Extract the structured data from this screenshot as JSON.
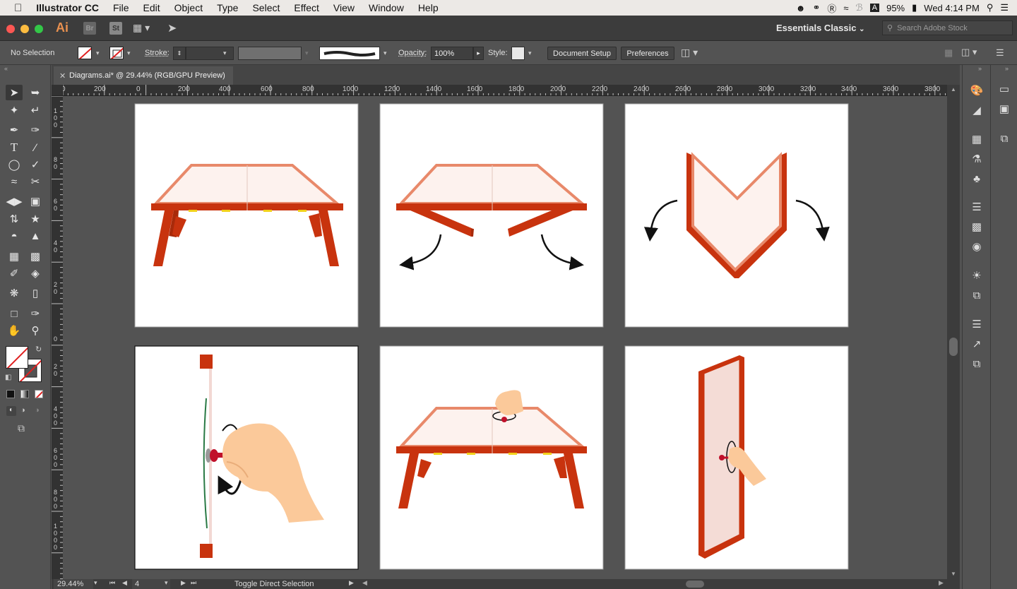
{
  "menubar": {
    "app_name": "Illustrator CC",
    "items": [
      "File",
      "Edit",
      "Object",
      "Type",
      "Select",
      "Effect",
      "View",
      "Window",
      "Help"
    ],
    "battery": "95%",
    "clock": "Wed 4:14 PM"
  },
  "appbar": {
    "ai_logo": "Ai",
    "bridge": "Br",
    "stock": "St",
    "workspace": "Essentials Classic",
    "search_placeholder": "Search Adobe Stock"
  },
  "control": {
    "selection": "No Selection",
    "stroke_label": "Stroke:",
    "opacity_label": "Opacity:",
    "opacity_value": "100%",
    "style_label": "Style:",
    "document_setup": "Document Setup",
    "preferences": "Preferences"
  },
  "document": {
    "tab_title": "Diagrams.ai* @ 29.44% (RGB/GPU Preview)"
  },
  "rulers": {
    "h_ticks": [
      "0",
      "200",
      "0",
      "200",
      "400",
      "600",
      "800",
      "1000",
      "1200",
      "1400",
      "1600",
      "1800",
      "2000",
      "2200",
      "2400",
      "2600",
      "2800",
      "3000",
      "3200",
      "3400",
      "3600",
      "3800"
    ],
    "v_ticks": [
      "1\n0\n0",
      "8\n0",
      "6\n0",
      "4\n0",
      "2\n0",
      "0",
      "2\n0",
      "4\n0\n0",
      "6\n0\n0",
      "8\n0\n0",
      "1\n0\n0\n0"
    ]
  },
  "status": {
    "zoom": "29.44%",
    "artboard_number": "4",
    "tool_hint": "Toggle Direct Selection"
  },
  "colors": {
    "table_red": "#c8330e",
    "table_top": "#fdf2ee",
    "table_edge": "#e8896a",
    "hand_skin": "#fbc99a",
    "pin_red": "#c0102a"
  },
  "icons": {
    "tools": [
      "selection-icon",
      "direct-selection-icon",
      "magic-wand-icon",
      "lasso-icon",
      "pen-icon",
      "curvature-icon",
      "type-icon",
      "line-icon",
      "ellipse-icon",
      "paintbrush-icon",
      "shaper-icon",
      "scissors-icon",
      "rotate-icon",
      "scale-icon",
      "width-icon",
      "puppet-warp-icon",
      "shape-builder-icon",
      "live-paint-icon",
      "mesh-icon",
      "gradient-icon",
      "eyedropper-icon",
      "blend-icon",
      "symbol-sprayer-icon",
      "graph-icon",
      "artboard-icon",
      "slice-icon",
      "hand-icon",
      "zoom-icon"
    ]
  }
}
